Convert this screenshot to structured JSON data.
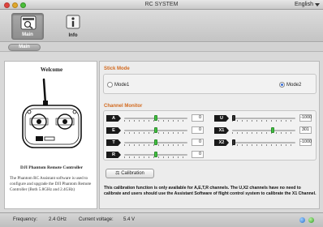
{
  "window": {
    "title": "RC SYSTEM",
    "language": "English"
  },
  "toolbar": {
    "main_label": "Main",
    "info_label": "Info"
  },
  "breadcrumb": {
    "label": "Main"
  },
  "welcome": {
    "title": "Welcome",
    "controller_name": "DJI Phantom Remote Controller",
    "description": "The Phantom RC Assistant software is used to configure and upgrade the DJI Phantom Remote Controller (Both 5.8GHz and 2.4GHz)"
  },
  "stick_mode": {
    "title": "Stick Mode",
    "options": [
      {
        "label": "Mode1",
        "selected": false
      },
      {
        "label": "Mode2",
        "selected": true
      }
    ]
  },
  "channel_monitor": {
    "title": "Channel Monitor",
    "left_channels": [
      {
        "name": "A",
        "value": "0",
        "level": 0.5
      },
      {
        "name": "E",
        "value": "0",
        "level": 0.5
      },
      {
        "name": "T",
        "value": "0",
        "level": 0.5
      },
      {
        "name": "R",
        "value": "0",
        "level": 0.5
      }
    ],
    "right_channels": [
      {
        "name": "U",
        "value": "-1000",
        "level": 0.0
      },
      {
        "name": "X1",
        "value": "301",
        "level": 0.65
      },
      {
        "name": "X2",
        "value": "-1000",
        "level": 0.0
      }
    ]
  },
  "calibration": {
    "button_label": "Calibration",
    "note": "This calibration function is only available for A,E,T,R channels. The U,X2 channels have no need to calibrate and users should use the Assistant Software of flight control system to calibrate the X1 Channel."
  },
  "status": {
    "frequency_label": "Frequency:",
    "frequency_value": "2.4 GHz",
    "voltage_label": "Current voltage:",
    "voltage_value": "5.4 V"
  },
  "colors": {
    "section_title": "#d2691e",
    "knob_green": "#3fbf3f",
    "led_blue": "#2b6fc9",
    "led_green": "#2c9a22"
  }
}
